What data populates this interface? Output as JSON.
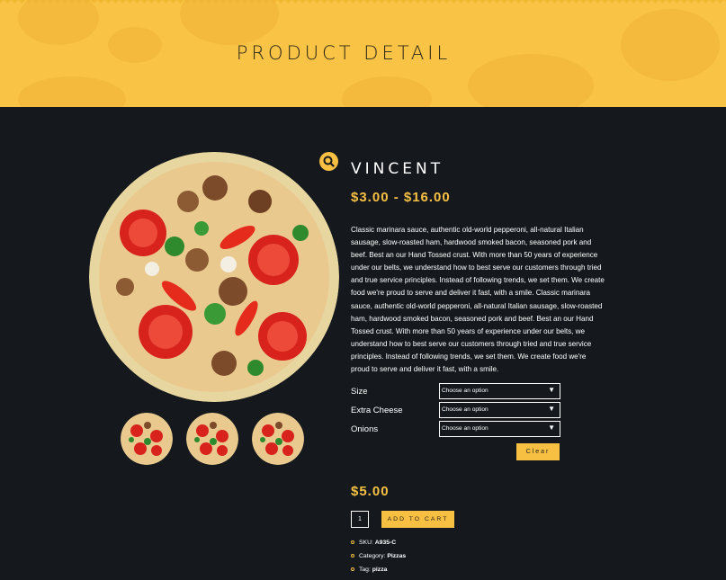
{
  "header": {
    "title": "PRODUCT DETAIL"
  },
  "product": {
    "name": "VINCENT",
    "price_range": "$3.00 - $16.00",
    "description": "Classic marinara sauce, authentic old-world pepperoni, all-natural Italian sausage, slow-roasted ham, hardwood smoked bacon, seasoned pork and beef. Best an our Hand Tossed crust. With more than 50 years of experience under our belts, we understand how to best serve our customers through tried and true service principles. Instead of following trends, we set them. We create food we're proud to serve and deliver it fast, with a smile. Classic marinara sauce, authentic old-world pepperoni, all-natural Italian sausage, slow-roasted ham, hardwood smoked bacon, seasoned pork and beef. Best an our Hand Tossed crust. With more than 50 years of experience under our belts, we understand how to best serve our customers through tried and true service principles. Instead of following trends, we set them. We create food we're proud to serve and deliver it fast, with a smile.",
    "variations": [
      {
        "label": "Size",
        "value": "Choose an option"
      },
      {
        "label": "Extra Cheese",
        "value": "Choose an option"
      },
      {
        "label": "Onions",
        "value": "Choose an option"
      }
    ],
    "clear_label": "Clear",
    "price": "$5.00",
    "quantity": "1",
    "add_to_cart_label": "ADD TO CART",
    "meta": [
      {
        "key": "SKU:",
        "value": "A935-C"
      },
      {
        "key": "Category:",
        "value": "Pizzas"
      },
      {
        "key": "Tag:",
        "value": "pizza"
      }
    ]
  },
  "icons": {
    "zoom": "search-icon",
    "select_arrow": "triangle-down-icon",
    "meta_bullet": "circle-bullet-icon"
  },
  "colors": {
    "accent": "#f7c043",
    "background": "#15191d",
    "banner": "#f9c445"
  }
}
